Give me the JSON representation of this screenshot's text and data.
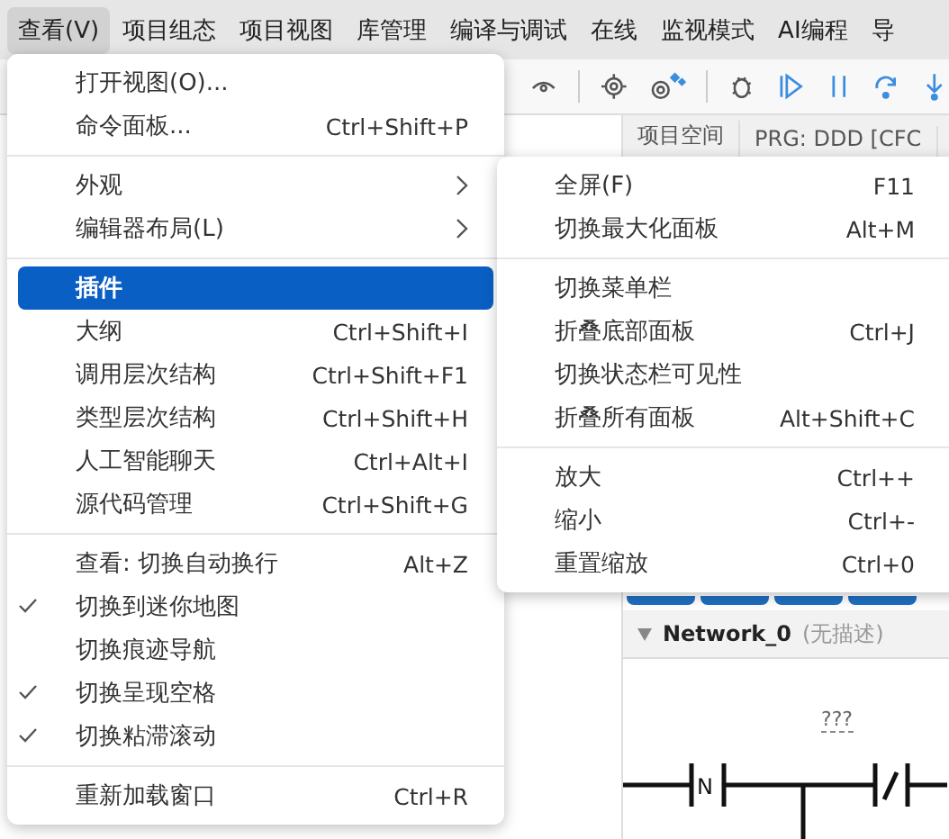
{
  "menubar": [
    {
      "label": "查看(V)",
      "selected": true
    },
    {
      "label": "项目组态",
      "selected": false
    },
    {
      "label": "项目视图",
      "selected": false
    },
    {
      "label": "库管理",
      "selected": false
    },
    {
      "label": "编译与调试",
      "selected": false
    },
    {
      "label": "在线",
      "selected": false
    },
    {
      "label": "监视模式",
      "selected": false
    },
    {
      "label": "AI编程",
      "selected": false
    },
    {
      "label": "导",
      "selected": false
    }
  ],
  "editor_tabs": [
    "项目空间",
    "PRG: DDD [CFC"
  ],
  "network": {
    "title": "Network_0",
    "description": "(无描述)",
    "expanded": true,
    "variable": "???",
    "contacts": [
      {
        "kind": "edge",
        "label": "N"
      },
      {
        "kind": "negated"
      }
    ]
  },
  "view_menu": {
    "groups": [
      [
        {
          "label": "打开视图(O)...",
          "submenu": false,
          "checked": false,
          "selected": false
        },
        {
          "label": "命令面板...",
          "shortcut": "Ctrl+Shift+P",
          "submenu": false,
          "checked": false,
          "selected": false
        }
      ],
      [
        {
          "label": "外观",
          "submenu": true,
          "checked": false,
          "selected": false
        },
        {
          "label": "编辑器布局(L)",
          "submenu": true,
          "checked": false,
          "selected": false
        }
      ],
      [
        {
          "label": "插件",
          "submenu": false,
          "checked": false,
          "selected": true
        },
        {
          "label": "大纲",
          "shortcut": "Ctrl+Shift+I",
          "submenu": false,
          "checked": false,
          "selected": false
        },
        {
          "label": "调用层次结构",
          "shortcut": "Ctrl+Shift+F1",
          "submenu": false,
          "checked": false,
          "selected": false
        },
        {
          "label": "类型层次结构",
          "shortcut": "Ctrl+Shift+H",
          "submenu": false,
          "checked": false,
          "selected": false
        },
        {
          "label": "人工智能聊天",
          "shortcut": "Ctrl+Alt+I",
          "submenu": false,
          "checked": false,
          "selected": false
        },
        {
          "label": "源代码管理",
          "shortcut": "Ctrl+Shift+G",
          "submenu": false,
          "checked": false,
          "selected": false
        }
      ],
      [
        {
          "label": "查看: 切换自动换行",
          "shortcut": "Alt+Z",
          "submenu": false,
          "checked": false,
          "selected": false
        },
        {
          "label": "切换到迷你地图",
          "submenu": false,
          "checked": true,
          "selected": false
        },
        {
          "label": "切换痕迹导航",
          "submenu": false,
          "checked": false,
          "selected": false
        },
        {
          "label": "切换呈现空格",
          "submenu": false,
          "checked": true,
          "selected": false
        },
        {
          "label": "切换粘滞滚动",
          "submenu": false,
          "checked": true,
          "selected": false
        }
      ],
      [
        {
          "label": "重新加载窗口",
          "shortcut": "Ctrl+R",
          "submenu": false,
          "checked": false,
          "selected": false
        }
      ]
    ]
  },
  "appearance_submenu": {
    "groups": [
      [
        {
          "label": "全屏(F)",
          "shortcut": "F11"
        },
        {
          "label": "切换最大化面板",
          "shortcut": "Alt+M"
        }
      ],
      [
        {
          "label": "切换菜单栏"
        },
        {
          "label": "折叠底部面板",
          "shortcut": "Ctrl+J"
        },
        {
          "label": "切换状态栏可见性"
        },
        {
          "label": "折叠所有面板",
          "shortcut": "Alt+Shift+C"
        }
      ],
      [
        {
          "label": "放大",
          "shortcut": "Ctrl++"
        },
        {
          "label": "缩小",
          "shortcut": "Ctrl+-"
        },
        {
          "label": "重置缩放",
          "shortcut": "Ctrl+0"
        }
      ]
    ]
  }
}
